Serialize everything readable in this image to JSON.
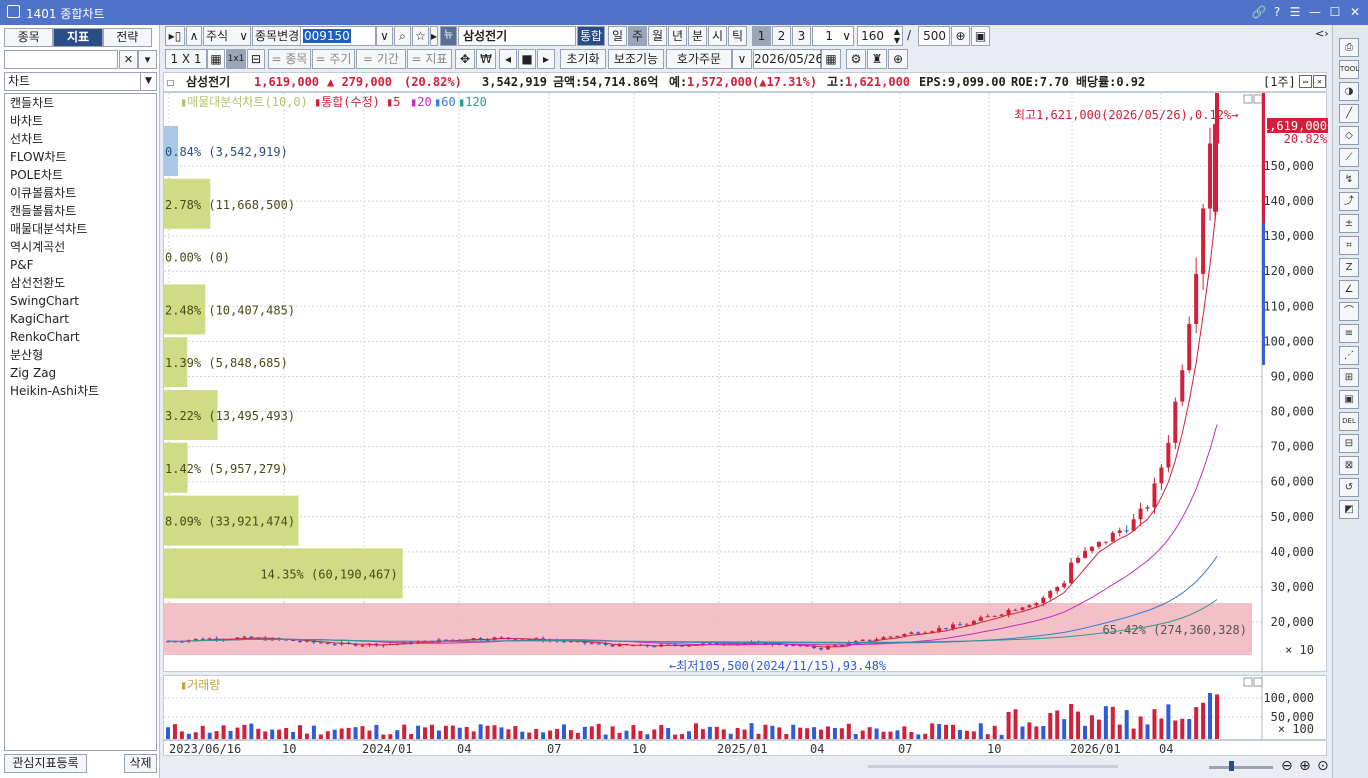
{
  "window": {
    "title": "1401 종합차트",
    "buttons": [
      "🔗",
      "?",
      "☰",
      "—",
      "☐",
      "✕"
    ]
  },
  "left_panel": {
    "tabs": [
      "종목",
      "지표",
      "전략"
    ],
    "active_tab": 1,
    "category": "차트",
    "items": [
      "캔들차트",
      "바차트",
      "선차트",
      "FLOW차트",
      "POLE차트",
      "이큐볼륨차트",
      "캔들볼륨차트",
      "매물대분석차트",
      "역시계곡선",
      "P&F",
      "삼선전환도",
      "SwingChart",
      "KagiChart",
      "RenkoChart",
      "분산형",
      "Zig Zag",
      "Heikin-Ashi차트"
    ],
    "register_button": "관심지표등록",
    "delete_button": "삭제"
  },
  "toolbar1": {
    "market": "주식",
    "change_label": "종목변경",
    "code": "009150",
    "stock_name": "삼성전기",
    "integrated": "통합",
    "periods": [
      "일",
      "주",
      "월",
      "년",
      "분",
      "시",
      "틱"
    ],
    "active_period": "주",
    "multiples": [
      "1",
      "2",
      "3"
    ],
    "multiple_value": "1",
    "count": "160",
    "slash": "/",
    "total": "500"
  },
  "toolbar2": {
    "layout_label": "1 X 1",
    "layout_alt": "1x1",
    "buttons": [
      "= 종목",
      "= 주기",
      "= 기간",
      "= 지표"
    ],
    "currency": "₩",
    "reset": "초기화",
    "aux": "보조기능",
    "order": "호가주문",
    "date": "2026/05/26"
  },
  "info": {
    "checkbox": "☐",
    "name": "삼성전기",
    "price": "1,619,000",
    "change": "▲ 279,000",
    "pct": "(20.82%)",
    "volume": "3,542,919",
    "amount": "금액:54,714.86억",
    "prev_label": "예:",
    "prev": "1,572,000(▲17.31%)",
    "high_label": "고:",
    "high": "1,621,000",
    "eps": "EPS:9,099.00",
    "roe": "ROE:7.70",
    "div": "배당률:0.92",
    "period_tag": "[1주]"
  },
  "legend": {
    "volume_profile": "매물대분석차트(10,0)",
    "main": "통합(수정)",
    "ma": [
      "5",
      "20",
      "60",
      "120"
    ],
    "ma_colors": [
      "#d3203a",
      "#c02fbf",
      "#3b7bd4",
      "#2a9a8a"
    ]
  },
  "annotations": {
    "high_note": "최고1,621,000(2026/05/26),0.12%",
    "low_note": "최저105,500(2024/11/15),93.48%",
    "current_price_tag": "1,619,000",
    "current_pct_tag": "20.82%",
    "price_unit": "× 10",
    "volume_legend": "거래량",
    "volume_unit": "× 100"
  },
  "chart_data": {
    "type": "candlestick",
    "y_ticks": [
      "150,000",
      "140,000",
      "130,000",
      "120,000",
      "110,000",
      "100,000",
      "90,000",
      "80,000",
      "70,000",
      "60,000",
      "50,000",
      "40,000",
      "30,000",
      "20,000"
    ],
    "ylim": [
      10000,
      165000
    ],
    "volume_ticks": [
      "100,000",
      "50,000"
    ],
    "x_ticks": [
      "2023/06/16",
      "10",
      "2024/01",
      "04",
      "07",
      "10",
      "2025/01",
      "04",
      "07",
      "10",
      "2026/01",
      "04"
    ],
    "volume_profile": [
      {
        "pct": "0.84%",
        "vol": "(3,542,919)",
        "ratio": 0.0129,
        "highlight": false
      },
      {
        "pct": "2.78%",
        "vol": "(11,668,500)",
        "ratio": 0.0425,
        "highlight": false
      },
      {
        "pct": "0.00%",
        "vol": "(0)",
        "ratio": 0.0,
        "highlight": false
      },
      {
        "pct": "2.48%",
        "vol": "(10,407,485)",
        "ratio": 0.0379,
        "highlight": false
      },
      {
        "pct": "1.39%",
        "vol": "(5,848,685)",
        "ratio": 0.0213,
        "highlight": false
      },
      {
        "pct": "3.22%",
        "vol": "(13,495,493)",
        "ratio": 0.0492,
        "highlight": false
      },
      {
        "pct": "1.42%",
        "vol": "(5,957,279)",
        "ratio": 0.0217,
        "highlight": false
      },
      {
        "pct": "8.09%",
        "vol": "(33,921,474)",
        "ratio": 0.1236,
        "highlight": false
      },
      {
        "pct": "14.35%",
        "vol": "(60,190,467)",
        "ratio": 0.2194,
        "highlight": false
      },
      {
        "pct": "65.42%",
        "vol": "(274,360,328)",
        "ratio": 1.0,
        "highlight": true
      }
    ]
  },
  "right_tools": [
    "⎙",
    "TOOL",
    "◑",
    "╱",
    "◇",
    "⟋",
    "↯",
    "⤴",
    "±",
    "⌗",
    "Z",
    "∠",
    "⌒",
    "≡",
    "⋰",
    "⊞",
    "▣",
    "DEL",
    "⊟",
    "⊠",
    "↺",
    "◩"
  ]
}
